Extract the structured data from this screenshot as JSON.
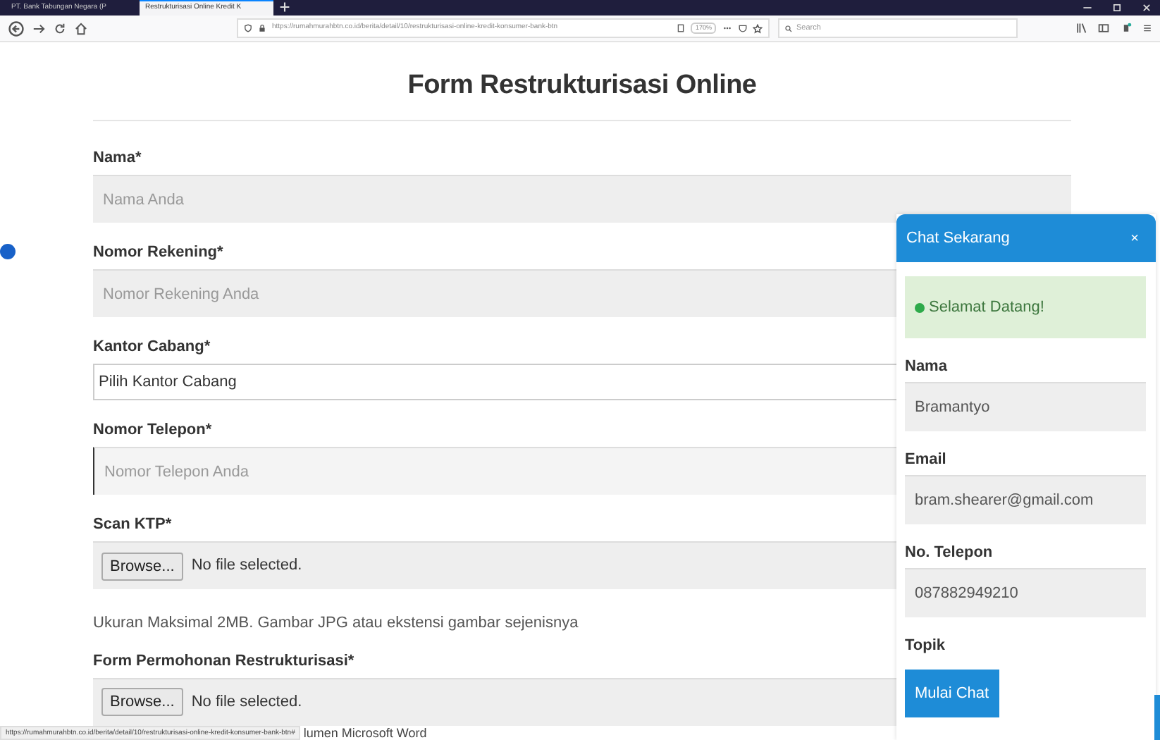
{
  "browser": {
    "tabs": [
      {
        "title": "PT. Bank Tabungan Negara (P",
        "selected": false
      },
      {
        "title": "Restrukturisasi Online Kredit K",
        "selected": true
      }
    ],
    "url": "https://rumahmurahbtn.co.id/berita/detail/10/restrukturisasi-online-kredit-konsumer-bank-btn",
    "zoom": "170%",
    "search_placeholder": "Search"
  },
  "form": {
    "title": "Form Restrukturisasi Online",
    "fields": [
      {
        "kind": "text",
        "label": "Nama*",
        "placeholder": "Nama Anda",
        "focused": false
      },
      {
        "kind": "text",
        "label": "Nomor Rekening*",
        "placeholder": "Nomor Rekening Anda",
        "focused": false
      },
      {
        "kind": "select",
        "label": "Kantor Cabang*",
        "value": "Pilih Kantor Cabang"
      },
      {
        "kind": "text",
        "label": "Nomor Telepon*",
        "placeholder": "Nomor Telepon Anda",
        "focused": true
      },
      {
        "kind": "file",
        "label": "Scan KTP*",
        "button": "Browse...",
        "status": "No file selected.",
        "hint": "Ukuran Maksimal 2MB. Gambar JPG atau ekstensi gambar sejenisnya"
      },
      {
        "kind": "file",
        "label": "Form Permohonan Restrukturisasi*",
        "button": "Browse...",
        "status": "No file selected."
      }
    ]
  },
  "chat": {
    "title": "Chat Sekarang",
    "close": "×",
    "welcome": "Selamat Datang!",
    "fields": [
      {
        "label": "Nama",
        "value": "Bramantyo"
      },
      {
        "label": "Email",
        "value": "bram.shearer@gmail.com"
      },
      {
        "label": "No. Telepon",
        "value": "087882949210"
      }
    ],
    "topic_label": "Topik",
    "button": "Mulai Chat"
  },
  "status_bar": {
    "url": "https://rumahmurahbtn.co.id/berita/detail/10/restrukturisasi-online-kredit-konsumer-bank-btn#",
    "behind_text": "lumen Microsoft Word"
  }
}
